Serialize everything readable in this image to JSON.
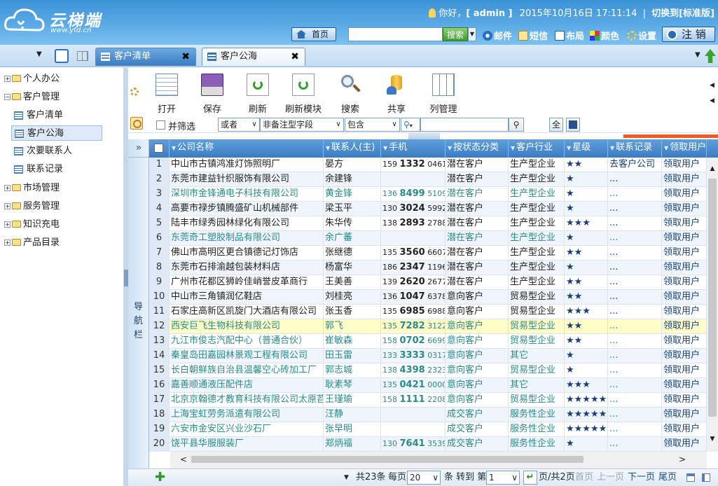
{
  "header": {
    "logo_text": "云梯端",
    "logo_url": "www.ytd.cn",
    "greeting": "你好，",
    "user": "[ admin ]",
    "datetime": "2015年10月16日  17:11:14",
    "switch_label": "切换到[标准版]",
    "home_label": "首页",
    "search_placeholder": "",
    "search_label": "搜索",
    "links": [
      {
        "label": "邮件",
        "icon": "mail-icon"
      },
      {
        "label": "短信",
        "icon": "sms-icon"
      },
      {
        "label": "布局",
        "icon": "layout-icon"
      },
      {
        "label": "颜色",
        "icon": "color-icon"
      },
      {
        "label": "设置",
        "icon": "gear-icon"
      }
    ],
    "logout_label": "注 销"
  },
  "tabs": [
    {
      "label": "客户清单",
      "active": false
    },
    {
      "label": "客户公海",
      "active": true
    }
  ],
  "sidebar": {
    "items": [
      {
        "label": "个人办公",
        "expanded": false
      },
      {
        "label": "客户管理",
        "expanded": true,
        "children": [
          {
            "label": "客户清单"
          },
          {
            "label": "客户公海",
            "selected": true
          },
          {
            "label": "次要联系人"
          },
          {
            "label": "联系记录"
          }
        ]
      },
      {
        "label": "市场管理",
        "expanded": false
      },
      {
        "label": "服务管理",
        "expanded": false
      },
      {
        "label": "知识充电",
        "expanded": false
      },
      {
        "label": "产品目录",
        "expanded": false
      }
    ]
  },
  "toolbar": {
    "buttons": [
      {
        "label": "打开",
        "icon": "open-icon"
      },
      {
        "label": "保存",
        "icon": "save-icon"
      },
      {
        "label": "刷新",
        "icon": "refresh-icon"
      },
      {
        "label": "刷新模块",
        "icon": "refresh-module-icon"
      },
      {
        "label": "搜索",
        "icon": "search-icon"
      },
      {
        "label": "共享",
        "icon": "share-icon"
      },
      {
        "label": "列管理",
        "icon": "columns-icon"
      }
    ]
  },
  "filter": {
    "combine_label": "并筛选",
    "logic": "或者",
    "field": "非备注型字段",
    "op": "包含",
    "value": ""
  },
  "navstrip_label": "导航栏",
  "grid": {
    "columns": [
      "公司名称",
      "联系人(主)",
      "手机",
      "按状态分类",
      "客户行业",
      "星级",
      "联系记录",
      "领取用户"
    ],
    "rows": [
      {
        "n": "1",
        "company": "中山市古镇鸿准灯饰照明厂",
        "contact": "晏方",
        "p1": "159",
        "p2": "1332",
        "p3": "0461",
        "status": "潜在客户",
        "industry": "生产型企业",
        "stars": "★★",
        "record": "去客户公司",
        "action": "领取用户",
        "green": false
      },
      {
        "n": "2",
        "company": "东莞市建益针织服饰有限公司",
        "contact": "余建锋",
        "p1": "",
        "p2": "",
        "p3": "",
        "status": "潜在客户",
        "industry": "生产型企业",
        "stars": "★",
        "record": "...",
        "action": "领取用户",
        "green": false
      },
      {
        "n": "3",
        "company": "深圳市金锋通电子科技有限公司",
        "contact": "黄金锋",
        "p1": "136",
        "p2": "8499",
        "p3": "5109",
        "status": "潜在客户",
        "industry": "生产型企业",
        "stars": "★",
        "record": "...",
        "action": "领取用户",
        "green": true
      },
      {
        "n": "4",
        "company": "高要市禄步镇腾盛矿山机械部件",
        "contact": "梁玉平",
        "p1": "130",
        "p2": "3024",
        "p3": "5992",
        "status": "潜在客户",
        "industry": "生产型企业",
        "stars": "★",
        "record": "...",
        "action": "领取用户",
        "green": false
      },
      {
        "n": "5",
        "company": "陆丰市绿秀园林绿化有限公司",
        "contact": "朱华传",
        "p1": "138",
        "p2": "2893",
        "p3": "2788",
        "status": "潜在客户",
        "industry": "生产型企业",
        "stars": "★★★",
        "record": "...",
        "action": "领取用户",
        "green": false
      },
      {
        "n": "6",
        "company": "东莞奇工塑胶制品有限公司",
        "contact": "余广蕃",
        "p1": "",
        "p2": "",
        "p3": "",
        "status": "潜在客户",
        "industry": "生产型企业",
        "stars": "★",
        "record": "...",
        "action": "领取用户",
        "green": true
      },
      {
        "n": "7",
        "company": "佛山市高明区更合镇德记灯饰店",
        "contact": "张继德",
        "p1": "135",
        "p2": "3560",
        "p3": "6607",
        "status": "潜在客户",
        "industry": "生产型企业",
        "stars": "★★",
        "record": "...",
        "action": "领取用户",
        "green": false
      },
      {
        "n": "8",
        "company": "东莞市石排渝越包装材料店",
        "contact": "杨富华",
        "p1": "186",
        "p2": "2347",
        "p3": "1196",
        "status": "潜在客户",
        "industry": "生产型企业",
        "stars": "★",
        "record": "...",
        "action": "领取用户",
        "green": false
      },
      {
        "n": "9",
        "company": "广州市花都区狮岭佳峭誉皮革商行",
        "contact": "王美善",
        "p1": "139",
        "p2": "2620",
        "p3": "2677",
        "status": "潜在客户",
        "industry": "生产型企业",
        "stars": "★★",
        "record": "...",
        "action": "领取用户",
        "green": false
      },
      {
        "n": "10",
        "company": "中山市三角镇润亿鞋店",
        "contact": "刘桂亮",
        "p1": "136",
        "p2": "1047",
        "p3": "6378",
        "status": "意向客户",
        "industry": "贸易型企业",
        "stars": "★★",
        "record": "...",
        "action": "领取用户",
        "green": false
      },
      {
        "n": "11",
        "company": "石家庄高新区凯旋门大酒店有限公司",
        "contact": "张玉香",
        "p1": "135",
        "p2": "6985",
        "p3": "6988",
        "status": "意向客户",
        "industry": "贸易型企业",
        "stars": "★★★",
        "record": "...",
        "action": "领取用户",
        "green": false
      },
      {
        "n": "12",
        "company": "西安巨飞生物科技有限公司",
        "contact": "郭飞",
        "p1": "135",
        "p2": "7282",
        "p3": "3122",
        "status": "意向客户",
        "industry": "贸易型企业",
        "stars": "★★",
        "record": "...",
        "action": "领取用户",
        "green": true
      },
      {
        "n": "13",
        "company": "九江市俊志汽配中心（普通合伙）",
        "contact": "崔敏森",
        "p1": "158",
        "p2": "0702",
        "p3": "6699",
        "status": "意向客户",
        "industry": "贸易型企业",
        "stars": "★★",
        "record": "...",
        "action": "领取用户",
        "green": true
      },
      {
        "n": "14",
        "company": "秦皇岛田嘉园林景观工程有限公司",
        "contact": "田玉雷",
        "p1": "133",
        "p2": "3333",
        "p3": "0317",
        "status": "意向客户",
        "industry": "其它",
        "stars": "★",
        "record": "...",
        "action": "领取用户",
        "green": true
      },
      {
        "n": "15",
        "company": "长白朝鲜族自治县温馨空心砖加工厂",
        "contact": "郭志城",
        "p1": "138",
        "p2": "4398",
        "p3": "2323",
        "status": "意向客户",
        "industry": "贸易型企业",
        "stars": "★",
        "record": "...",
        "action": "领取用户",
        "green": true
      },
      {
        "n": "16",
        "company": "嘉善顺通液压配件店",
        "contact": "耿素琴",
        "p1": "135",
        "p2": "0421",
        "p3": "0000",
        "status": "意向客户",
        "industry": "其它",
        "stars": "★★★",
        "record": "...",
        "action": "领取用户",
        "green": true
      },
      {
        "n": "17",
        "company": "北京京翰德才教育科技有限公司太原苕",
        "contact": "王瑾瑜",
        "p1": "158",
        "p2": "1111",
        "p3": "2208",
        "status": "意向客户",
        "industry": "贸易型企业",
        "stars": "★★★★★",
        "record": "...",
        "action": "领取用户",
        "green": true
      },
      {
        "n": "18",
        "company": "上海宝虹劳务派遣有限公司",
        "contact": "汪静",
        "p1": "",
        "p2": "",
        "p3": "",
        "status": "成交客户",
        "industry": "服务性企业",
        "stars": "★★★★★",
        "record": "...",
        "action": "领取用户",
        "green": true
      },
      {
        "n": "19",
        "company": "六安市金安区兴业沙石厂",
        "contact": "张早明",
        "p1": "",
        "p2": "",
        "p3": "",
        "status": "成交客户",
        "industry": "服务性企业",
        "stars": "★★★★★",
        "record": "...",
        "action": "领取用户",
        "green": true
      },
      {
        "n": "20",
        "company": "饶平县华服服装厂",
        "contact": "郑炳福",
        "p1": "130",
        "p2": "7641",
        "p3": "3539",
        "status": "成交客户",
        "industry": "服务性企业",
        "stars": "★",
        "record": "...",
        "action": "领取用户",
        "green": true
      }
    ]
  },
  "pager": {
    "total": "共23条",
    "per_page_label": "每页",
    "per_page": "20",
    "goto_label": "条 转到 第",
    "page": "1",
    "page_of": "页/共2页",
    "first": "首页",
    "prev": "上一页",
    "next": "下一页",
    "last": "尾页"
  },
  "colors": {
    "header_blue": "#3c92d6",
    "table_header": "#3b7cc2",
    "highlight_row": "#fffec8",
    "teal_text": "#2a8a8a"
  }
}
